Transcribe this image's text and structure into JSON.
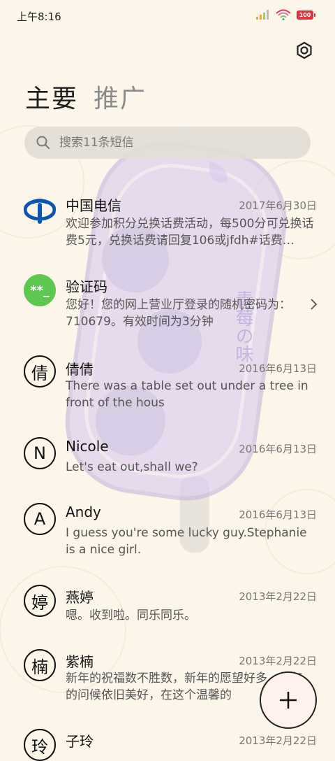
{
  "status_bar": {
    "time": "上午8:16",
    "battery": "100"
  },
  "tabs": [
    {
      "label": "主要",
      "active": true
    },
    {
      "label": "推广",
      "active": false
    }
  ],
  "search": {
    "placeholder": "搜索11条短信"
  },
  "conversations": [
    {
      "name": "中国电信",
      "date": "2017年6月30日",
      "avatar_type": "telecom-logo",
      "avatar_text": "",
      "preview": "欢迎参加积分兑换话费活动，每500分可兑换话费5元，兑换话费请回复106或jfdh#话费…"
    },
    {
      "name": "验证码",
      "date": "",
      "avatar_type": "code",
      "avatar_text": "**_",
      "preview": "您好！您的网上营业厅登录的随机密码为：710679。有效时间为3分钟"
    },
    {
      "name": "倩倩",
      "date": "2016年6月13日",
      "avatar_type": "letter",
      "avatar_text": "倩",
      "preview": "There was a table set out under a tree in front of the hous"
    },
    {
      "name": "Nicole",
      "date": "2016年6月13日",
      "avatar_type": "letter",
      "avatar_text": "N",
      "preview": "Let's eat out,shall we?"
    },
    {
      "name": "Andy",
      "date": "2016年6月13日",
      "avatar_type": "letter",
      "avatar_text": "A",
      "preview": "I guess you're some lucky guy.Stephanie is a nice girl."
    },
    {
      "name": "燕婷",
      "date": "2013年2月22日",
      "avatar_type": "letter",
      "avatar_text": "婷",
      "preview": "嗯。收到啦。同乐同乐。"
    },
    {
      "name": "紫楠",
      "date": "2013年2月22日",
      "avatar_type": "letter",
      "avatar_text": "楠",
      "preview": "新年的祝福数不胜数，新年的愿望好多，新年的问候依旧美好，在这个温馨的"
    },
    {
      "name": "子玲",
      "date": "2013年2月22日",
      "avatar_type": "letter",
      "avatar_text": "玲",
      "preview": ""
    }
  ],
  "wallpaper": {
    "text": "青莓の味"
  },
  "colors": {
    "background": "#fbf6e9",
    "code_avatar": "#5dc750",
    "telecom_blue": "#0a56b3"
  }
}
